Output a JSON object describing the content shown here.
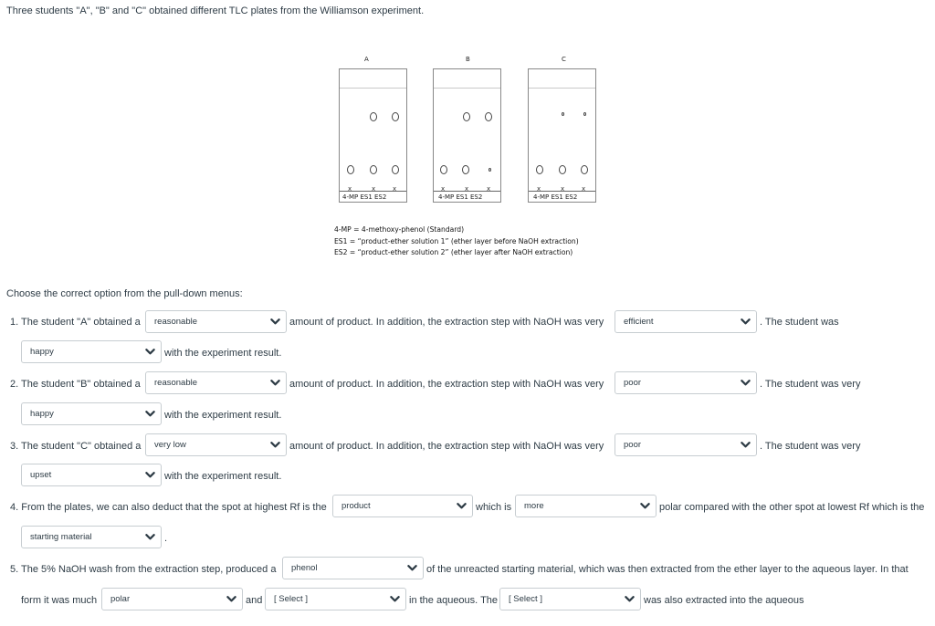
{
  "intro": "Three students \"A\", \"B\" and \"C\" obtained different TLC plates from the Williamson experiment.",
  "figure": {
    "plates": [
      {
        "label": "A",
        "lanes": [
          "4-MP",
          "ES1",
          "ES2"
        ]
      },
      {
        "label": "B",
        "lanes": [
          "4-MP",
          "ES1",
          "ES2"
        ]
      },
      {
        "label": "C",
        "lanes": [
          "4-MP",
          "ES1",
          "ES2"
        ]
      }
    ],
    "lane_text": "4-MP  ES1  ES2",
    "baseline_mark": "x",
    "legend": [
      "4-MP = 4-methoxy-phenol (Standard)",
      "ES1 = “product-ether solution 1” (ether layer before NaOH extraction)",
      "ES2 = “product-ether solution 2” (ether layer after NaOH extraction)"
    ]
  },
  "instructions": "Choose the correct option from the pull-down menus:",
  "q1": {
    "t1": "1. The student \"A\" obtained a",
    "s1": "reasonable",
    "t2": "amount of product. In addition, the extraction step with NaOH was very",
    "s2": "efficient",
    "t3": ". The student was",
    "s3": "happy",
    "t4": "with the experiment result."
  },
  "q2": {
    "t1": "2. The student \"B\" obtained a",
    "s1": "reasonable",
    "t2": "amount of product. In addition, the extraction step with NaOH was very",
    "s2": "poor",
    "t3": ". The student was very",
    "s3": "happy",
    "t4": "with the experiment result."
  },
  "q3": {
    "t1": "3. The student \"C\" obtained a",
    "s1": "very low",
    "t2": "amount of product. In addition, the extraction step with NaOH was very",
    "s2": "poor",
    "t3": ". The student was very",
    "s3": "upset",
    "t4": "with the experiment result."
  },
  "q4": {
    "t1": "4. From the plates, we can also deduct that the spot at highest Rf is the",
    "s1": "product",
    "t2": "which is",
    "s2": "more",
    "t3": "polar compared with the other spot at lowest Rf which is the",
    "s3": "starting material",
    "t4": "."
  },
  "q5": {
    "t1": "5. The 5% NaOH wash from the extraction step, produced a",
    "s1": "phenol",
    "t2": "of the unreacted starting material, which was then extracted from the ether layer to the aqueous layer. In that",
    "t3": "form it was much",
    "s2": "polar",
    "t4": "and",
    "s3": "[ Select ]",
    "t5": "in the aqueous. The",
    "s4": "[ Select ]",
    "t6": "was also extracted  into the aqueous"
  }
}
